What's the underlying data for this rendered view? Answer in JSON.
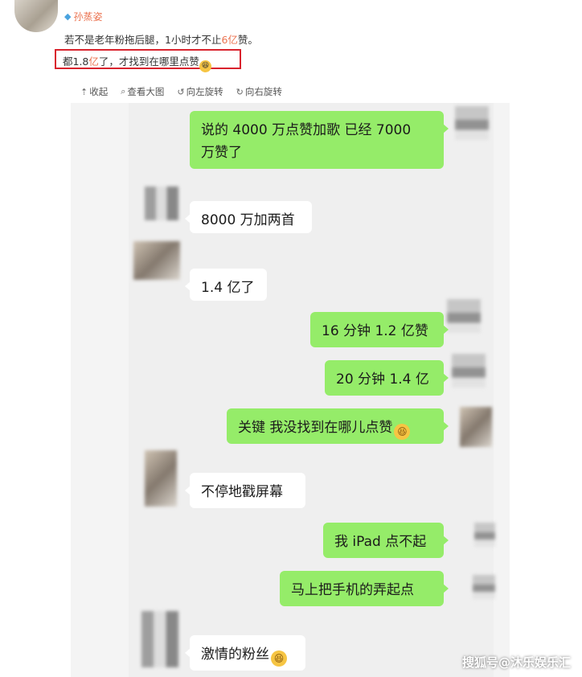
{
  "post": {
    "username": "孙蒸姿",
    "line1_a": "若不是老年粉拖后腿，1小时才不止",
    "line1_hl": "6亿",
    "line1_b": "赞。",
    "line2_a": "都1.8",
    "line2_hl": "亿",
    "line2_b": "了，才找到在哪里点赞"
  },
  "toolbar": {
    "collapse": "收起",
    "view_large": "查看大图",
    "rotate_left": "向左旋转",
    "rotate_right": "向右旋转"
  },
  "chat": {
    "m1": "说的 4000 万点赞加歌 已经 7000",
    "m1b": "万赞了",
    "m2": "8000 万加两首",
    "m3": "1.4 亿了",
    "m4": "16 分钟 1.2 亿赞",
    "m5": "20 分钟 1.4 亿",
    "m6": "关键 我没找到在哪儿点赞",
    "m7": "不停地戳屏幕",
    "m8": "我 iPad 点不起",
    "m9": "马上把手机的弄起点",
    "m10": "激情的粉丝"
  },
  "watermark": "搜狐号@沐乐娱乐汇",
  "colors": {
    "accent": "#eb7350",
    "highlight_box": "#d9232d",
    "my_bubble": "#95ec69",
    "other_bubble": "#ffffff"
  }
}
